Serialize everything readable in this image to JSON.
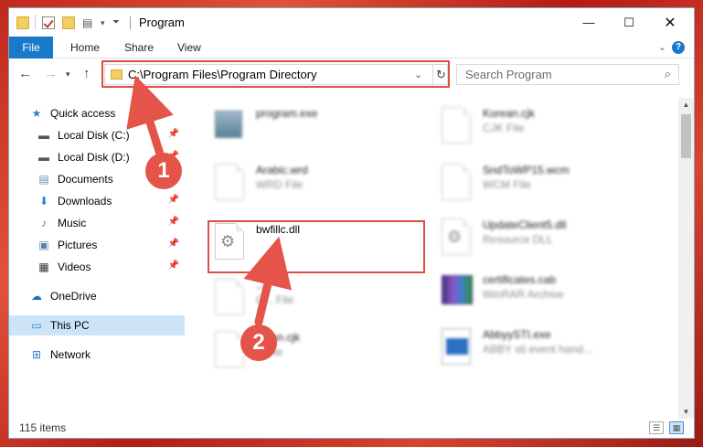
{
  "window": {
    "title": "Program"
  },
  "ribbon": {
    "tabs": [
      "File",
      "Home",
      "Share",
      "View"
    ],
    "help_label": "?"
  },
  "address": {
    "path": "C:\\Program Files\\Program Directory",
    "search_placeholder": "Search Program"
  },
  "sidebar": {
    "items": [
      {
        "label": "Quick access",
        "icon": "star-icon",
        "pinned": false
      },
      {
        "label": "Local Disk (C:)",
        "icon": "drive-icon",
        "pinned": true
      },
      {
        "label": "Local Disk (D:)",
        "icon": "drive-icon",
        "pinned": true
      },
      {
        "label": "Documents",
        "icon": "documents-icon",
        "pinned": true
      },
      {
        "label": "Downloads",
        "icon": "download-icon",
        "pinned": true
      },
      {
        "label": "Music",
        "icon": "music-icon",
        "pinned": true
      },
      {
        "label": "Pictures",
        "icon": "pictures-icon",
        "pinned": true
      },
      {
        "label": "Videos",
        "icon": "videos-icon",
        "pinned": true
      },
      {
        "label": "OneDrive",
        "icon": "cloud-icon",
        "pinned": false
      },
      {
        "label": "This PC",
        "icon": "computer-icon",
        "pinned": false,
        "selected": true
      },
      {
        "label": "Network",
        "icon": "network-icon",
        "pinned": false
      }
    ]
  },
  "files": {
    "left": [
      {
        "name": "program.exe",
        "type": "",
        "icon": "exe-icon"
      },
      {
        "name": "Arabic.wrd",
        "type": "WRD File",
        "icon": "file-icon"
      },
      {
        "name": "bwfillc.dll",
        "type": "",
        "icon": "dll-icon",
        "highlighted": true
      },
      {
        "name": "...k",
        "type": "C... File",
        "icon": "file-icon"
      },
      {
        "name": "...ean.cjk",
        "type": "...File",
        "icon": "file-icon"
      }
    ],
    "right": [
      {
        "name": "Korean.cjk",
        "type": "CJK File",
        "icon": "file-icon"
      },
      {
        "name": "SndToWP15.wcm",
        "type": "WCM File",
        "icon": "file-icon"
      },
      {
        "name": "UpdateClient5.dll",
        "type": "Resource DLL",
        "icon": "dll-icon"
      },
      {
        "name": "certificates.cab",
        "type": "WinRAR Archive",
        "icon": "archive-icon"
      },
      {
        "name": "AbbyySTI.exe",
        "type": "ABBY sti event hand...",
        "icon": "app-icon"
      }
    ]
  },
  "status": {
    "item_count": "115 items"
  },
  "annotations": {
    "badge1": "1",
    "badge2": "2"
  },
  "colors": {
    "accent": "#1979ca",
    "highlight": "#e04b42",
    "badge": "#e55448",
    "selected": "#cce4f7"
  }
}
